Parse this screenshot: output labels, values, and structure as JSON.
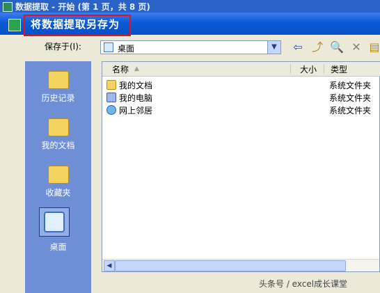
{
  "parent_window": {
    "title": "数据提取 - 开始 (第 1 页，共 8 页)"
  },
  "dialog": {
    "title": "将数据提取另存为",
    "save_in_label": "保存于(I):",
    "save_in_value": "桌面"
  },
  "toolbar": {
    "back_icon": "back-arrow-icon",
    "up_icon": "up-folder-icon",
    "search_icon": "search-web-icon",
    "delete_icon": "delete-x-icon",
    "new_folder_icon": "new-folder-icon"
  },
  "places_bar": {
    "items": [
      {
        "label": "历史记录",
        "icon": "history-folder-icon"
      },
      {
        "label": "我的文档",
        "icon": "my-documents-icon"
      },
      {
        "label": "收藏夹",
        "icon": "favorites-folder-icon"
      },
      {
        "label": "桌面",
        "icon": "desktop-icon",
        "selected": true
      }
    ]
  },
  "file_list": {
    "columns": [
      "名称",
      "大小",
      "类型"
    ],
    "rows": [
      {
        "name": "我的文档",
        "size": "",
        "type": "系统文件夹",
        "icon": "my-documents-icon"
      },
      {
        "name": "我的电脑",
        "size": "",
        "type": "系统文件夹",
        "icon": "my-computer-icon"
      },
      {
        "name": "网上邻居",
        "size": "",
        "type": "系统文件夹",
        "icon": "network-places-icon"
      }
    ]
  },
  "watermark": {
    "text": "头条号 / excel成长课堂"
  },
  "colors": {
    "highlight_box": "#e8101a",
    "title_bar": "#0a5ad6",
    "places_bar": "#6e8fd5"
  }
}
